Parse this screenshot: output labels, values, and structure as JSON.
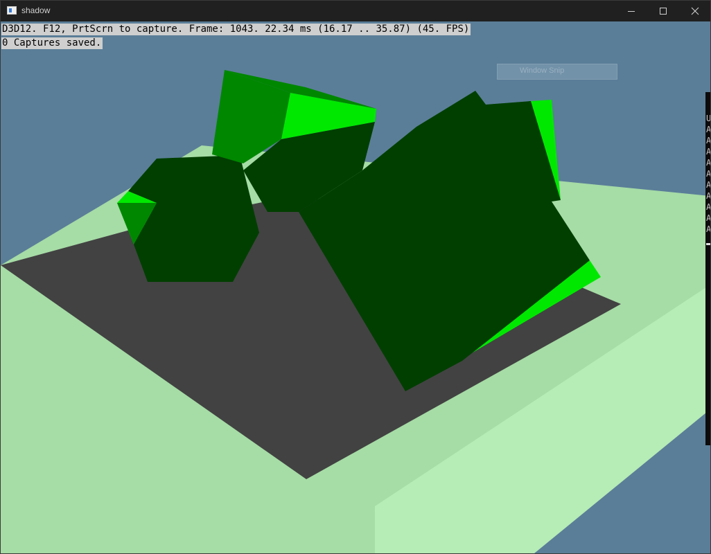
{
  "window": {
    "title": "shadow",
    "app_icon": "window-app-icon",
    "controls": {
      "minimize_icon": "minimize-icon",
      "maximize_icon": "maximize-icon",
      "close_icon": "close-icon"
    }
  },
  "hud": {
    "line1": "D3D12. F12, PrtScrn to capture. Frame: 1043. 22.34 ms (16.17 .. 35.87) (45. FPS)",
    "line2": "0 Captures saved."
  },
  "snip_overlay": {
    "label": "Window Snip"
  },
  "console_panel": {
    "first_chars": [
      "U",
      "A",
      "A",
      "A",
      "A",
      "A",
      "A",
      "A",
      "A",
      "A",
      "A"
    ]
  },
  "scene": {
    "colors": {
      "sky": "#5a7e98",
      "ground_lit": "#a6dca6",
      "ground_far": "#c2fac2",
      "shadow": "#424242",
      "cube_dark": "#003f00",
      "cube_mid": "#008700",
      "cube_bright": "#00e800"
    }
  }
}
